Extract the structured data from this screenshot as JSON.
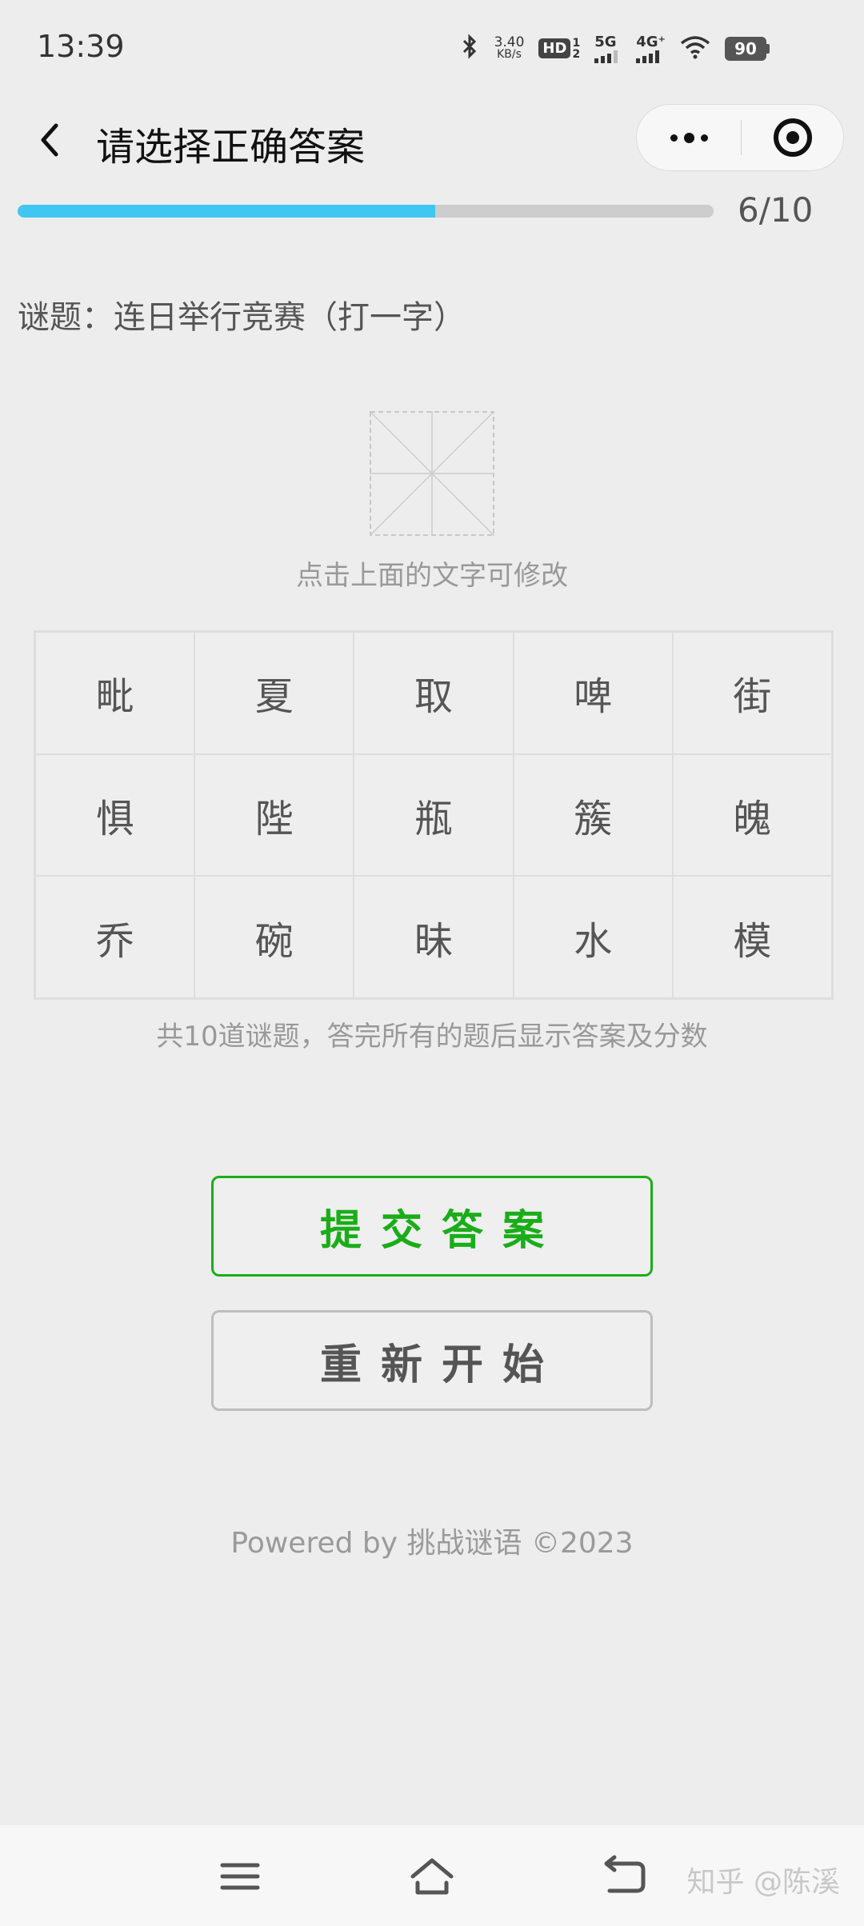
{
  "status_bar": {
    "time": "13:39",
    "net_speed_value": "3.40",
    "net_speed_unit": "KB/s",
    "hd_label": "HD",
    "sim_slots": "1\n2",
    "signal_5g": "5G",
    "signal_4g": "4G⁺",
    "battery": "90",
    "icons": [
      "bluetooth-icon",
      "hd-icon",
      "signal-5g-icon",
      "signal-4g-icon",
      "wifi-icon",
      "battery-icon"
    ]
  },
  "nav": {
    "title": "请选择正确答案",
    "icons": [
      "back-arrow-icon",
      "more-dots-icon",
      "close-target-icon"
    ]
  },
  "progress": {
    "current": 6,
    "total": 10,
    "fraction": 0.6,
    "label": "6/10",
    "fill_color": "#3fc7f2"
  },
  "riddle": {
    "text": "谜题：连日举行竞赛（打一字）"
  },
  "answer": {
    "hint": "点击上面的文字可修改"
  },
  "char_grid": {
    "rows": [
      [
        "毗",
        "夏",
        "取",
        "啤",
        "街"
      ],
      [
        "惧",
        "陛",
        "瓶",
        "簇",
        "魄"
      ],
      [
        "乔",
        "碗",
        "昧",
        "水",
        "模"
      ]
    ]
  },
  "note": "共10道谜题，答完所有的题后显示答案及分数",
  "buttons": {
    "submit": "提交答案",
    "restart": "重新开始"
  },
  "footer": "Powered by 挑战谜语 ©2023",
  "system_nav": {
    "icons": [
      "menu-icon",
      "home-icon",
      "back-icon"
    ],
    "watermark": "知乎 @陈溪"
  },
  "colors": {
    "accent_green": "#1aad19",
    "progress_blue": "#3fc7f2",
    "background": "#ededed"
  }
}
